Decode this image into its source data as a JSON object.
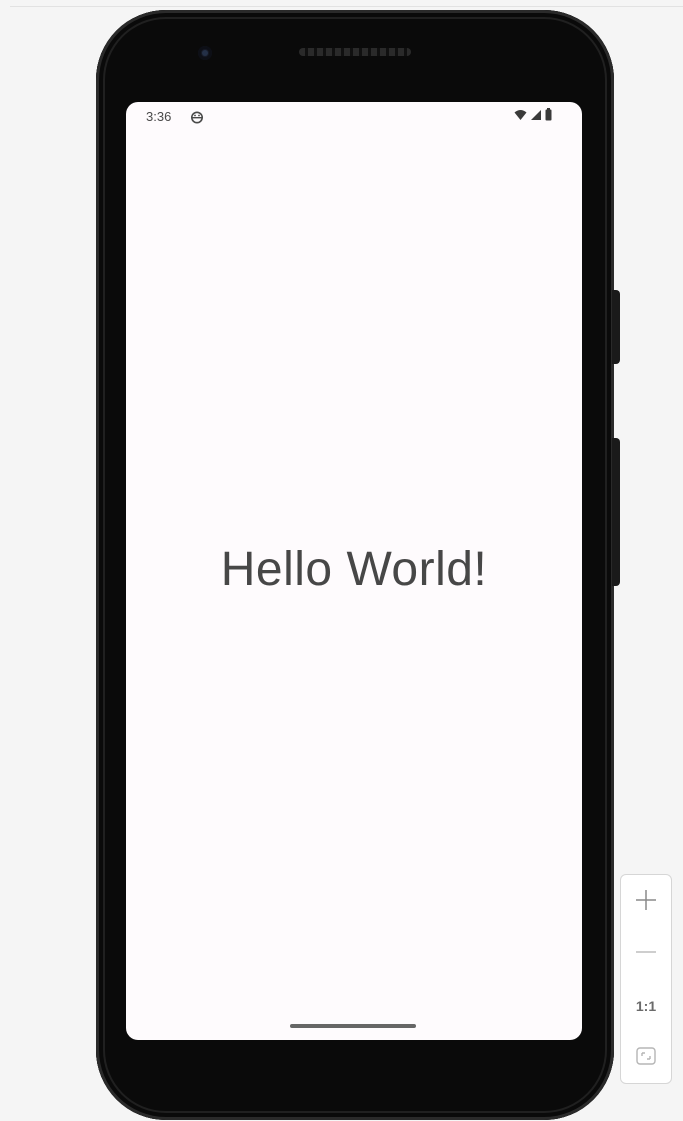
{
  "status_bar": {
    "time": "3:36"
  },
  "app": {
    "content_text": "Hello World!"
  },
  "zoom_controls": {
    "one_to_one_label": "1:1"
  },
  "icons": {
    "app": "android-head-icon",
    "wifi": "wifi-icon",
    "signal": "cell-signal-icon",
    "battery": "battery-icon",
    "zoom_in": "plus-icon",
    "zoom_out": "minus-icon",
    "fit": "fit-screen-icon"
  }
}
